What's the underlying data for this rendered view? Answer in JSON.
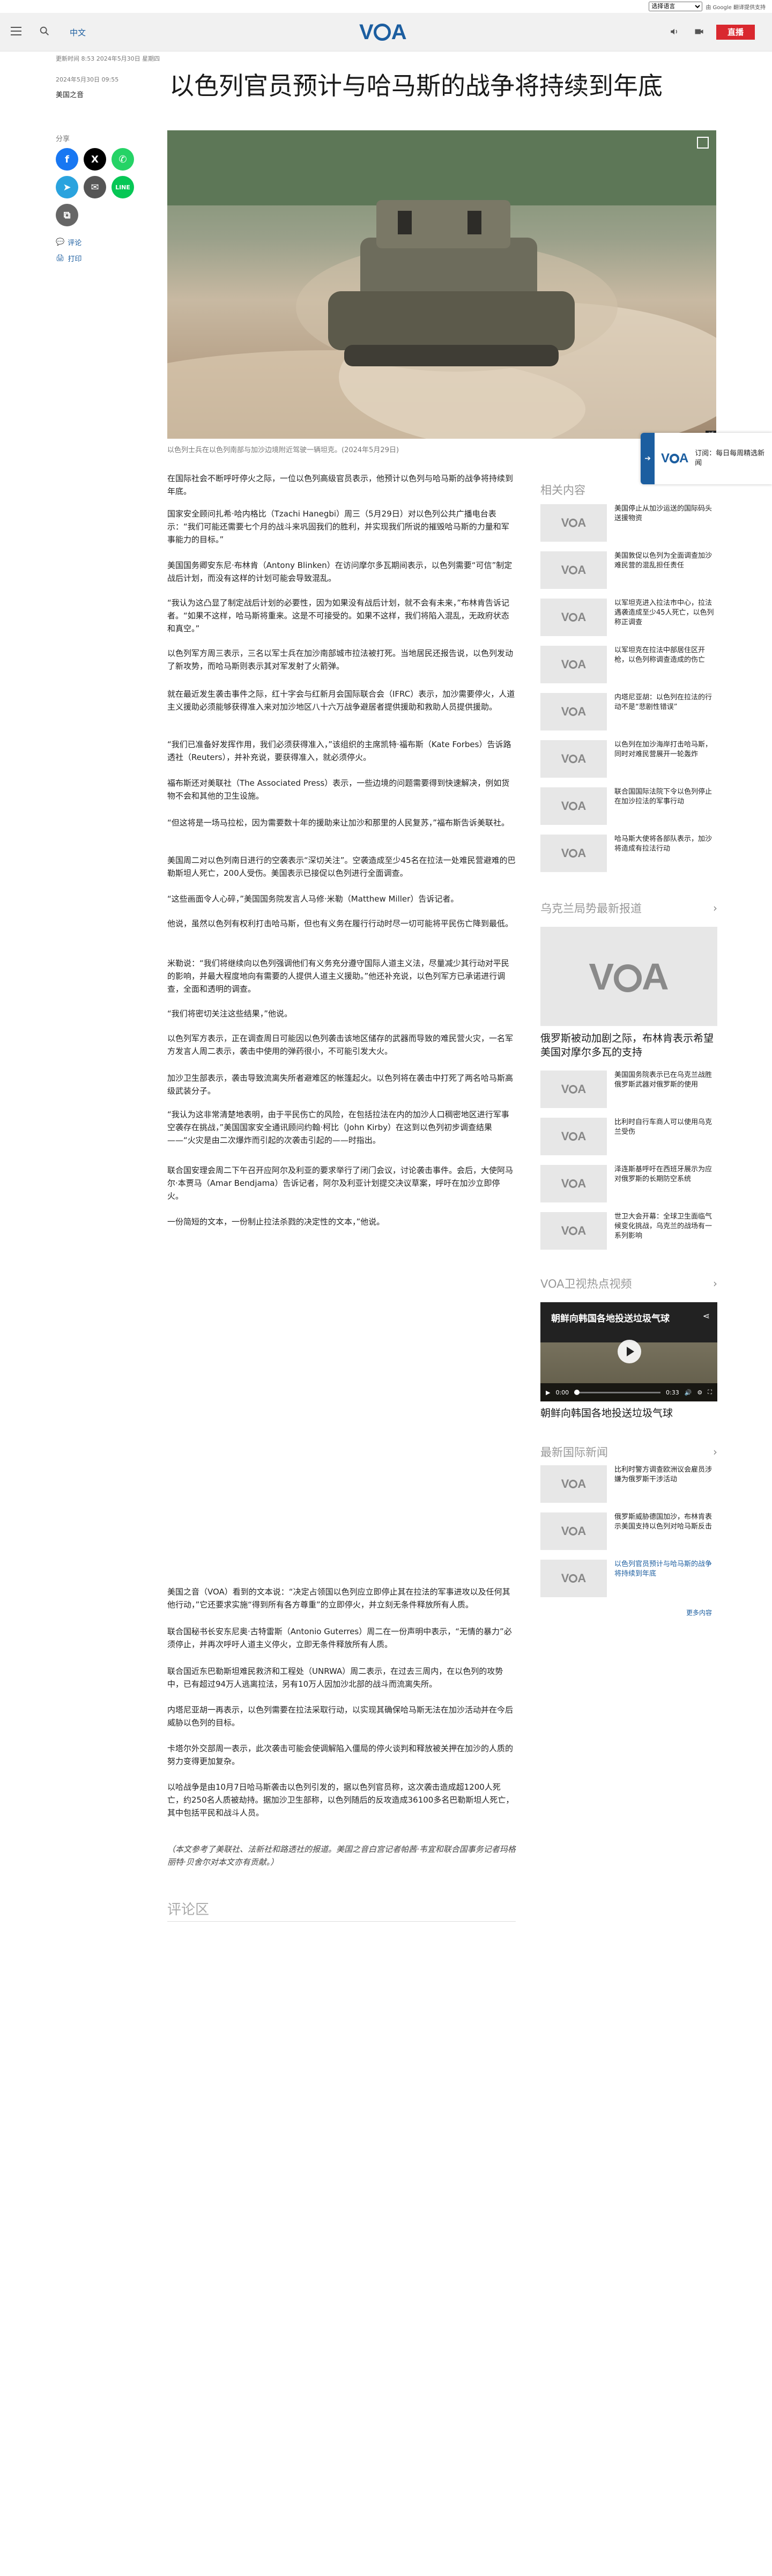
{
  "translate": {
    "select_label": "选择语言",
    "powered_by": "由 Google 翻译提供支持"
  },
  "header": {
    "lang_link": "中文",
    "logo": "VOA",
    "live_button": "直播"
  },
  "article": {
    "updated": "更新时间 8:53 2024年5月30日 星期四",
    "date": "2024年5月30日 09:55",
    "source": "美国之音",
    "title": "以色列官员预计与哈马斯的战争将持续到年底",
    "share_label": "分享",
    "comment_link": "评论",
    "print_link": "打印",
    "caption": "以色列士兵在以色列南部与加沙边境附近驾驶一辆坦克。(2024年5月29日)",
    "paragraphs": [
      "在国际社会不断呼吁停火之际，一位以色列高级官员表示，他预计以色列与哈马斯的战争将持续到年底。",
      "国家安全顾问扎希·哈内格比（Tzachi Hanegbi）周三（5月29日）对以色列公共广播电台表示：“我们可能还需要七个月的战斗来巩固我们的胜利，并实现我们所说的摧毁哈马斯的力量和军事能力的目标。”",
      "美国国务卿安东尼·布林肯（Antony Blinken）在访问摩尔多瓦期间表示，以色列需要“可信”制定战后计划，而没有这样的计划可能会导致混乱。",
      "“我认为这凸显了制定战后计划的必要性，因为如果没有战后计划，就不会有未来，”布林肯告诉记者。“如果不这样，哈马斯将重来。这是不可接受的。如果不这样，我们将陷入混乱，无政府状态和真空。”",
      "以色列军方周三表示，三名以军士兵在加沙南部城市拉法被打死。当地居民还报告说，以色列发动了新攻势，而哈马斯则表示其对军发射了火箭弹。",
      "就在最近发生袭击事件之际，红十字会与红新月会国际联合会（IFRC）表示，加沙需要停火，人道主义援助必须能够获得准入来对加沙地区八十六万战争避居者提供援助和救助人员提供援助。",
      "“我们已准备好发挥作用，我们必须获得准入，”该组织的主席凯特·福布斯（Kate Forbes）告诉路透社（Reuters），并补充说，要获得准入，就必须停火。",
      "福布斯还对美联社（The Associated Press）表示，一些边境的问题需要得到快速解决，例如货物不会和其他的卫生设施。",
      "“但这将是一场马拉松，因为需要数十年的援助来让加沙和那里的人民复苏，”福布斯告诉美联社。",
      "美国周二对以色列南日进行的空袭表示“深切关注”。空袭造成至少45名在拉法一处难民营避难的巴勒斯坦人死亡，200人受伤。美国表示已接促以色列进行全面调查。",
      "“这些画面令人心碎，”美国国务院发言人马修·米勒（Matthew Miller）告诉记者。",
      "他说，虽然以色列有权利打击哈马斯，但也有义务在履行行动时尽一切可能将平民伤亡降到最低。",
      "米勒说：“我们将继续向以色列强调他们有义务充分遵守国际人道主义法，尽量减少其行动对平民的影响，并最大程度地向有需要的人提供人道主义援助。”他还补充说，以色列军方已承诺进行调查，全面和透明的调查。",
      "“我们将密切关注这些结果，”他说。",
      "以色列军方表示，正在调查周日可能因以色列袭击该地区储存的武器而导致的难民营火灾，一名军方发言人周二表示，袭击中使用的弹药很小，不可能引发大火。",
      "加沙卫生部表示，袭击导致流离失所者避难区的帐篷起火。以色列将在袭击中打死了两名哈马斯高级武装分子。",
      "“我认为这非常清楚地表明，由于平民伤亡的风险，在包括拉法在内的加沙人口稠密地区进行军事空袭存在挑战，”美国国家安全通讯顾问约翰·柯比（John Kirby）在这到以色列初步调查结果——“火灾是由二次爆炸而引起的次袭击引起的——时指出。",
      "联合国安理会周二下午召开应阿尔及利亚的要求举行了闭门会议，讨论袭击事件。会后，大使阿马尔·本贾马（Amar Bendjama）告诉记者，阿尔及利亚计划提交决议草案，呼吁在加沙立即停火。",
      "一份简短的文本，一份制止拉法杀戮的决定性的文本，”他说。",
      "美国之音（VOA）看到的文本说：“决定占领国以色列应立即停止其在拉法的军事进攻以及任何其他行动，”它还要求实施“得到所有各方尊重”的立即停火，并立刻无条件释放所有人质。",
      "联合国秘书长安东尼奥·古特雷斯（Antonio Guterres）周二在一份声明中表示，“无情的暴力”必须停止，并再次呼吁人道主义停火，立即无条件释放所有人质。",
      "联合国近东巴勒斯坦难民救济和工程处（UNRWA）周二表示，在过去三周内，在以色列的攻势中，已有超过94万人逃离拉法，另有10万人因加沙北部的战斗而流离失所。",
      "内塔尼亚胡一再表示，以色列需要在拉法采取行动，以实现其确保哈马斯无法在加沙活动并在今后威胁以色列的目标。",
      "卡塔尔外交部周一表示，此次袭击可能会使调解陷入僵局的停火谈判和释放被关押在加沙的人质的努力变得更加复杂。",
      "以哈战争是由10月7日哈马斯袭击以色列引发的，据以色列官员称，这次袭击造成超1200人死亡，约250名人质被劫持。据加沙卫生部称，以色列随后的反攻造成36100多名巴勒斯坦人死亡，其中包括平民和战斗人员。",
      "（本文参考了美联社、法新社和路透社的报道。美国之音白宫记者帕茜·韦宜和联合国事务记者玛格丽特·贝舍尔对本文亦有贡献。）"
    ],
    "comments_heading": "评论区"
  },
  "sidebar": {
    "related_heading": "相关内容",
    "related": [
      "美国停止从加沙运送的国际码头送援物资",
      "美国敦促以色列为全面调查加沙难民营的混乱担任责任",
      "以军坦克进入拉法市中心，拉法遇袭造成至少45人死亡，以色列称正调查",
      "以军坦克在拉法中部居住区开枪，以色列称调查造成的伤亡",
      "内塔尼亚胡：以色列在拉法的行动不是“悲剧性错误”",
      "以色列在加沙海岸打击哈马斯，同时对难民营展开一轮轰炸",
      "联合国国际法院下令以色列停止在加沙拉法的军事行动",
      "哈马斯大使将各部队表示，加沙将造成有拉法行动"
    ],
    "ukraine_heading": "乌克兰局势最新报道",
    "ukraine_feature_title": "俄罗斯被动加剧之际，布林肯表示希望美国对摩尔多瓦的支持",
    "ukraine_items": [
      "美国国务院表示已在乌克兰战胜俄罗斯武器对俄罗斯的使用",
      "比利时自行车商人可以使用乌克兰受伤",
      "泽连斯基呼吁在西班牙展示为应对俄罗斯的长期防空系统",
      "世卫大会开幕：全球卫生面临气候变化挑战，乌克兰的战场有一系列影响"
    ],
    "video_heading": "VOA卫视热点视频",
    "video": {
      "title": "朝鲜向韩国各地投送垃圾气球",
      "time_current": "0:00",
      "time_total": "0:33"
    },
    "video_caption": "朝鲜向韩国各地投送垃圾气球",
    "intl_heading": "最新国际新闻",
    "intl_items": [
      "比利时警方调查欧洲议会雇员涉嫌为俄罗斯干涉活动",
      "俄罗斯威胁德国加沙，布林肯表示美国支持以色列对哈马斯反击",
      "以色列官员预计与哈马斯的战争将持续到年底"
    ],
    "more_link": "更多内容"
  },
  "side_widget": {
    "text": "订阅：每日每周精选新闻"
  },
  "colors": {
    "brand": "#1c5ea0",
    "live": "#d9282f",
    "facebook": "#1877f2",
    "x": "#000000",
    "whatsapp": "#25d366",
    "telegram": "#2aa3de",
    "email": "#555555",
    "line": "#06c755"
  }
}
